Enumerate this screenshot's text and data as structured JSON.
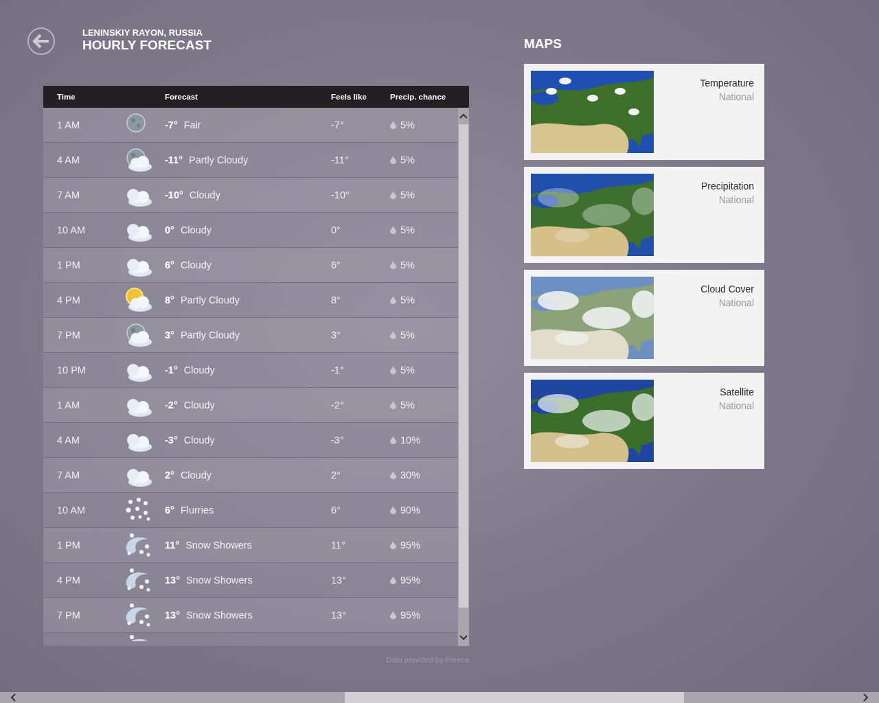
{
  "header": {
    "location": "LENINSKIY RAYON, RUSSIA",
    "title": "HOURLY FORECAST"
  },
  "table": {
    "columns": [
      "Time",
      "Forecast",
      "Feels like",
      "Precip. chance"
    ],
    "rows": [
      {
        "time": "1 AM",
        "kind": "moon",
        "temp": "-7°",
        "condition": "Fair",
        "feels_like": "-7°",
        "precip": "5%"
      },
      {
        "time": "4 AM",
        "kind": "moon_cloud",
        "temp": "-11°",
        "condition": "Partly Cloudy",
        "feels_like": "-11°",
        "precip": "5%"
      },
      {
        "time": "7 AM",
        "kind": "cloud",
        "temp": "-10°",
        "condition": "Cloudy",
        "feels_like": "-10°",
        "precip": "5%"
      },
      {
        "time": "10 AM",
        "kind": "cloud",
        "temp": "0°",
        "condition": "Cloudy",
        "feels_like": "0°",
        "precip": "5%"
      },
      {
        "time": "1 PM",
        "kind": "cloud",
        "temp": "6°",
        "condition": "Cloudy",
        "feels_like": "6°",
        "precip": "5%"
      },
      {
        "time": "4 PM",
        "kind": "sun_cloud",
        "temp": "8°",
        "condition": "Partly Cloudy",
        "feels_like": "8°",
        "precip": "5%"
      },
      {
        "time": "7 PM",
        "kind": "moon_cloud",
        "temp": "3°",
        "condition": "Partly Cloudy",
        "feels_like": "3°",
        "precip": "5%"
      },
      {
        "time": "10 PM",
        "kind": "cloud",
        "temp": "-1°",
        "condition": "Cloudy",
        "feels_like": "-1°",
        "precip": "5%"
      },
      {
        "time": "1 AM",
        "kind": "cloud",
        "temp": "-2°",
        "condition": "Cloudy",
        "feels_like": "-2°",
        "precip": "5%"
      },
      {
        "time": "4 AM",
        "kind": "cloud",
        "temp": "-3°",
        "condition": "Cloudy",
        "feels_like": "-3°",
        "precip": "10%"
      },
      {
        "time": "7 AM",
        "kind": "cloud",
        "temp": "2°",
        "condition": "Cloudy",
        "feels_like": "2°",
        "precip": "30%"
      },
      {
        "time": "10 AM",
        "kind": "flurries",
        "temp": "6°",
        "condition": "Flurries",
        "feels_like": "6°",
        "precip": "90%"
      },
      {
        "time": "1 PM",
        "kind": "snow_showers",
        "temp": "11°",
        "condition": "Snow Showers",
        "feels_like": "11°",
        "precip": "95%"
      },
      {
        "time": "4 PM",
        "kind": "snow_showers",
        "temp": "13°",
        "condition": "Snow Showers",
        "feels_like": "13°",
        "precip": "95%"
      },
      {
        "time": "7 PM",
        "kind": "snow_showers",
        "temp": "13°",
        "condition": "Snow Showers",
        "feels_like": "13°",
        "precip": "95%"
      }
    ],
    "partial_row": {
      "kind": "snow_showers"
    }
  },
  "credit": "Data provided by Foreca",
  "maps": {
    "title": "MAPS",
    "cards": [
      {
        "title": "Temperature",
        "subtitle": "National",
        "kind": "temperature"
      },
      {
        "title": "Precipitation",
        "subtitle": "National",
        "kind": "precipitation"
      },
      {
        "title": "Cloud Cover",
        "subtitle": "National",
        "kind": "cloud_cover"
      },
      {
        "title": "Satellite",
        "subtitle": "National",
        "kind": "satellite"
      }
    ]
  }
}
